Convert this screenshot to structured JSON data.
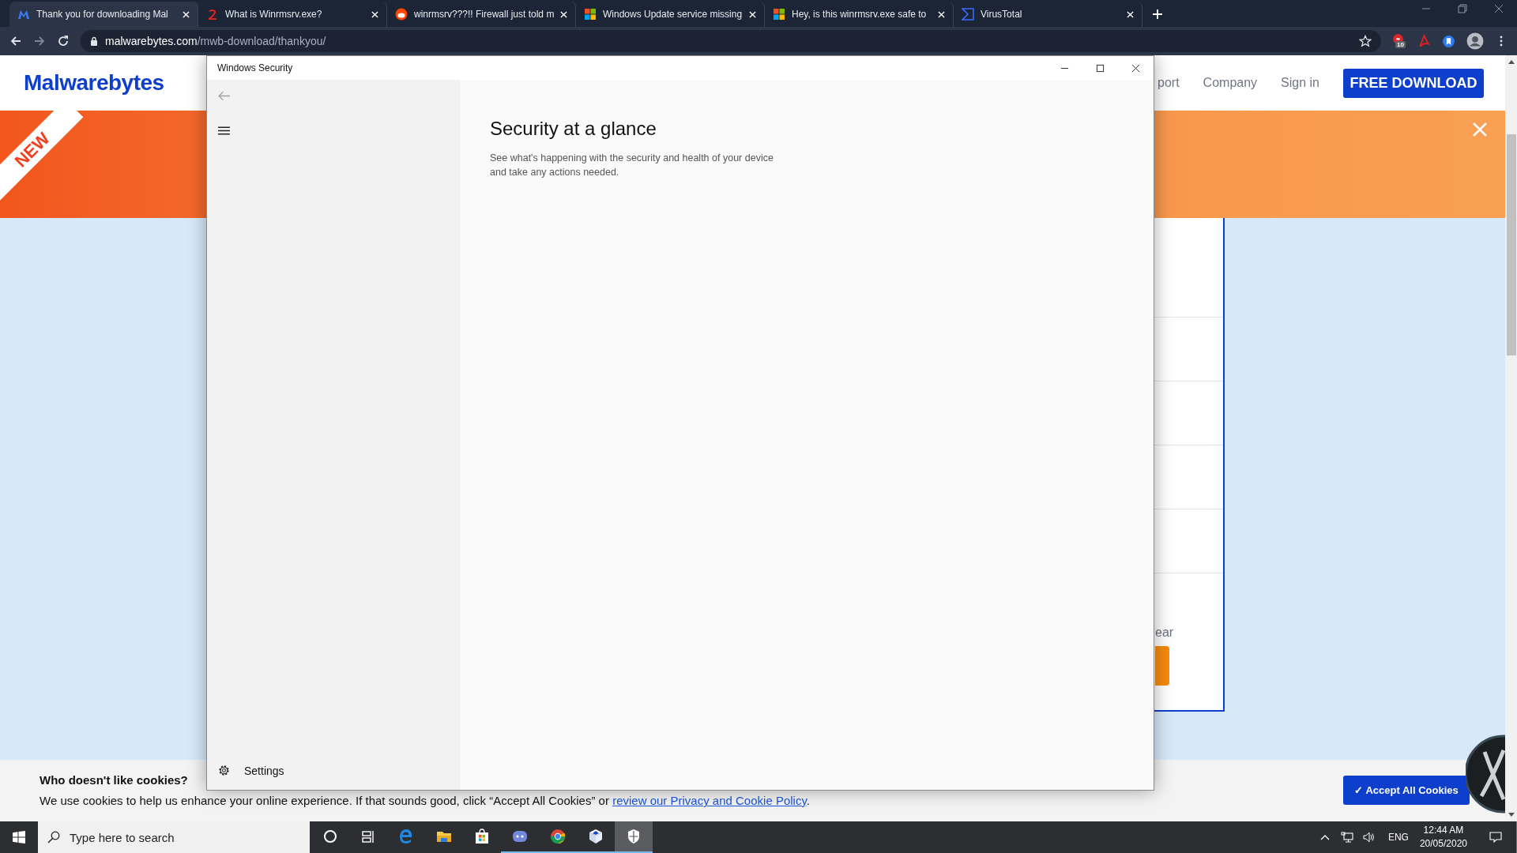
{
  "browser": {
    "tabs": [
      {
        "title": "Thank you for downloading Mal",
        "kind": "m",
        "selected": true
      },
      {
        "title": "What is Winrmsrv.exe?",
        "kind": "swirl",
        "selected": false
      },
      {
        "title": "winrmsrv???!! Firewall just told m",
        "kind": "alien",
        "selected": false
      },
      {
        "title": "Windows Update service missing",
        "kind": "squares",
        "selected": false
      },
      {
        "title": "Hey, is this winrmsrv.exe safe to",
        "kind": "squares",
        "selected": false
      },
      {
        "title": "VirusTotal",
        "kind": "sigma",
        "selected": false
      }
    ],
    "url_host": "malwarebytes.com",
    "url_path": "/mwb-download/thankyou/",
    "extension_badge": "10"
  },
  "page": {
    "logo": "Malwarebytes",
    "nav": [
      "port",
      "Company",
      "Sign in"
    ],
    "download_button": "FREE DOWNLOAD",
    "ribbon": "NEW",
    "card_text": "ear",
    "cookie": {
      "title": "Who doesn't like cookies?",
      "text": "We use cookies to help us enhance your online experience. If that sounds good, click “Accept All Cookies” or ",
      "link": "review our Privacy and Cookie Policy",
      "text_end": ".",
      "button": "✓ Accept All Cookies"
    }
  },
  "dialog": {
    "title": "Windows Security",
    "heading": "Security at a glance",
    "description": "See what's happening with the security and health of your device and take any actions needed.",
    "settings": "Settings"
  },
  "taskbar": {
    "search_placeholder": "Type here to search",
    "apps": [
      {
        "kind": "circle",
        "running": false,
        "selected": false
      },
      {
        "kind": "taskview",
        "running": false,
        "selected": false
      },
      {
        "kind": "browser-e",
        "running": false,
        "selected": false
      },
      {
        "kind": "folder",
        "running": false,
        "selected": false
      },
      {
        "kind": "store",
        "running": false,
        "selected": false
      },
      {
        "kind": "chat",
        "running": true,
        "selected": false
      },
      {
        "kind": "chrome",
        "running": true,
        "selected": false
      },
      {
        "kind": "box",
        "running": true,
        "selected": false
      },
      {
        "kind": "shield",
        "running": true,
        "selected": true
      }
    ],
    "language": "ENG",
    "time": "12:44 AM",
    "date": "20/05/2020"
  }
}
